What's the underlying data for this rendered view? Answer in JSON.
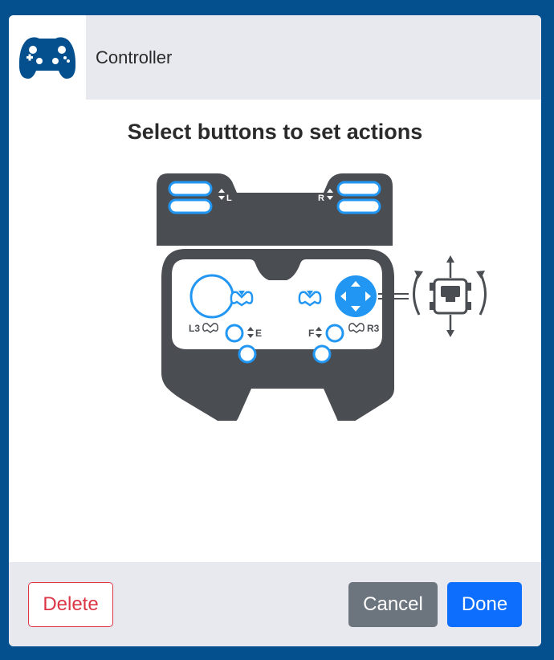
{
  "header": {
    "title": "Controller",
    "icon": "gamepad-icon"
  },
  "main": {
    "prompt": "Select buttons to set actions",
    "controller": {
      "labels": {
        "l": "L",
        "r": "R",
        "l3": "L3",
        "r3": "R3",
        "e": "E",
        "f": "F"
      }
    }
  },
  "footer": {
    "delete_label": "Delete",
    "cancel_label": "Cancel",
    "done_label": "Done"
  },
  "colors": {
    "frame": "#04508f",
    "accent": "#2196f3",
    "controller_body": "#4a4d52",
    "delete": "#dc3545",
    "cancel": "#6c757d",
    "done": "#0d6efd"
  }
}
